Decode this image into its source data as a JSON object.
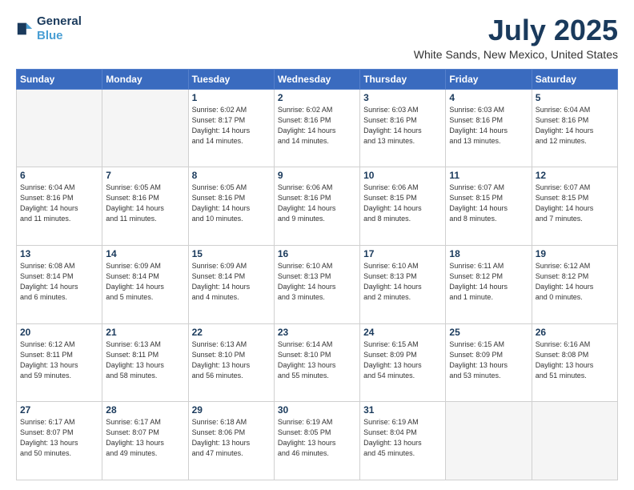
{
  "header": {
    "logo_line1": "General",
    "logo_line2": "Blue",
    "title": "July 2025",
    "subtitle": "White Sands, New Mexico, United States"
  },
  "days_of_week": [
    "Sunday",
    "Monday",
    "Tuesday",
    "Wednesday",
    "Thursday",
    "Friday",
    "Saturday"
  ],
  "weeks": [
    [
      {
        "day": "",
        "info": ""
      },
      {
        "day": "",
        "info": ""
      },
      {
        "day": "1",
        "info": "Sunrise: 6:02 AM\nSunset: 8:17 PM\nDaylight: 14 hours\nand 14 minutes."
      },
      {
        "day": "2",
        "info": "Sunrise: 6:02 AM\nSunset: 8:16 PM\nDaylight: 14 hours\nand 14 minutes."
      },
      {
        "day": "3",
        "info": "Sunrise: 6:03 AM\nSunset: 8:16 PM\nDaylight: 14 hours\nand 13 minutes."
      },
      {
        "day": "4",
        "info": "Sunrise: 6:03 AM\nSunset: 8:16 PM\nDaylight: 14 hours\nand 13 minutes."
      },
      {
        "day": "5",
        "info": "Sunrise: 6:04 AM\nSunset: 8:16 PM\nDaylight: 14 hours\nand 12 minutes."
      }
    ],
    [
      {
        "day": "6",
        "info": "Sunrise: 6:04 AM\nSunset: 8:16 PM\nDaylight: 14 hours\nand 11 minutes."
      },
      {
        "day": "7",
        "info": "Sunrise: 6:05 AM\nSunset: 8:16 PM\nDaylight: 14 hours\nand 11 minutes."
      },
      {
        "day": "8",
        "info": "Sunrise: 6:05 AM\nSunset: 8:16 PM\nDaylight: 14 hours\nand 10 minutes."
      },
      {
        "day": "9",
        "info": "Sunrise: 6:06 AM\nSunset: 8:16 PM\nDaylight: 14 hours\nand 9 minutes."
      },
      {
        "day": "10",
        "info": "Sunrise: 6:06 AM\nSunset: 8:15 PM\nDaylight: 14 hours\nand 8 minutes."
      },
      {
        "day": "11",
        "info": "Sunrise: 6:07 AM\nSunset: 8:15 PM\nDaylight: 14 hours\nand 8 minutes."
      },
      {
        "day": "12",
        "info": "Sunrise: 6:07 AM\nSunset: 8:15 PM\nDaylight: 14 hours\nand 7 minutes."
      }
    ],
    [
      {
        "day": "13",
        "info": "Sunrise: 6:08 AM\nSunset: 8:14 PM\nDaylight: 14 hours\nand 6 minutes."
      },
      {
        "day": "14",
        "info": "Sunrise: 6:09 AM\nSunset: 8:14 PM\nDaylight: 14 hours\nand 5 minutes."
      },
      {
        "day": "15",
        "info": "Sunrise: 6:09 AM\nSunset: 8:14 PM\nDaylight: 14 hours\nand 4 minutes."
      },
      {
        "day": "16",
        "info": "Sunrise: 6:10 AM\nSunset: 8:13 PM\nDaylight: 14 hours\nand 3 minutes."
      },
      {
        "day": "17",
        "info": "Sunrise: 6:10 AM\nSunset: 8:13 PM\nDaylight: 14 hours\nand 2 minutes."
      },
      {
        "day": "18",
        "info": "Sunrise: 6:11 AM\nSunset: 8:12 PM\nDaylight: 14 hours\nand 1 minute."
      },
      {
        "day": "19",
        "info": "Sunrise: 6:12 AM\nSunset: 8:12 PM\nDaylight: 14 hours\nand 0 minutes."
      }
    ],
    [
      {
        "day": "20",
        "info": "Sunrise: 6:12 AM\nSunset: 8:11 PM\nDaylight: 13 hours\nand 59 minutes."
      },
      {
        "day": "21",
        "info": "Sunrise: 6:13 AM\nSunset: 8:11 PM\nDaylight: 13 hours\nand 58 minutes."
      },
      {
        "day": "22",
        "info": "Sunrise: 6:13 AM\nSunset: 8:10 PM\nDaylight: 13 hours\nand 56 minutes."
      },
      {
        "day": "23",
        "info": "Sunrise: 6:14 AM\nSunset: 8:10 PM\nDaylight: 13 hours\nand 55 minutes."
      },
      {
        "day": "24",
        "info": "Sunrise: 6:15 AM\nSunset: 8:09 PM\nDaylight: 13 hours\nand 54 minutes."
      },
      {
        "day": "25",
        "info": "Sunrise: 6:15 AM\nSunset: 8:09 PM\nDaylight: 13 hours\nand 53 minutes."
      },
      {
        "day": "26",
        "info": "Sunrise: 6:16 AM\nSunset: 8:08 PM\nDaylight: 13 hours\nand 51 minutes."
      }
    ],
    [
      {
        "day": "27",
        "info": "Sunrise: 6:17 AM\nSunset: 8:07 PM\nDaylight: 13 hours\nand 50 minutes."
      },
      {
        "day": "28",
        "info": "Sunrise: 6:17 AM\nSunset: 8:07 PM\nDaylight: 13 hours\nand 49 minutes."
      },
      {
        "day": "29",
        "info": "Sunrise: 6:18 AM\nSunset: 8:06 PM\nDaylight: 13 hours\nand 47 minutes."
      },
      {
        "day": "30",
        "info": "Sunrise: 6:19 AM\nSunset: 8:05 PM\nDaylight: 13 hours\nand 46 minutes."
      },
      {
        "day": "31",
        "info": "Sunrise: 6:19 AM\nSunset: 8:04 PM\nDaylight: 13 hours\nand 45 minutes."
      },
      {
        "day": "",
        "info": ""
      },
      {
        "day": "",
        "info": ""
      }
    ]
  ]
}
